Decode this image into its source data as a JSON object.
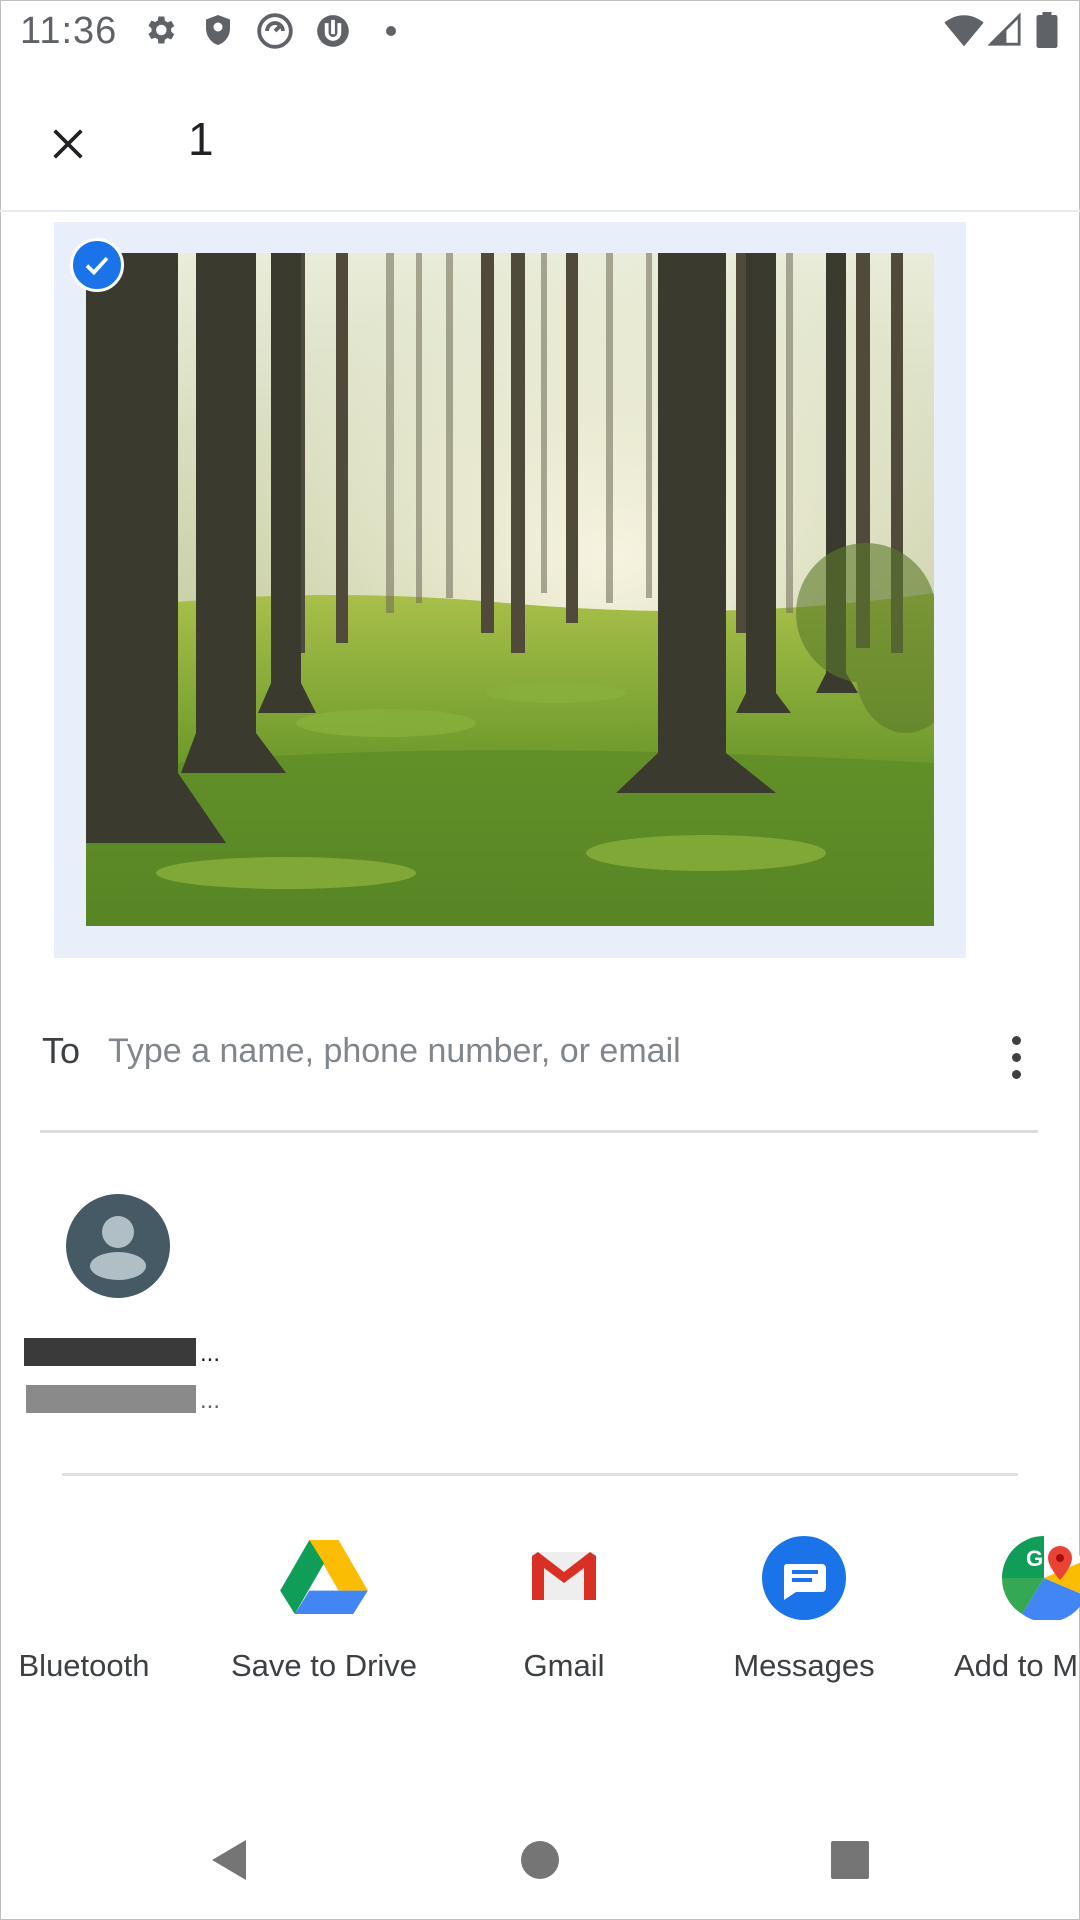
{
  "status_bar": {
    "time": "11:36",
    "left_icons": [
      "settings-icon",
      "shield-icon",
      "speed-icon",
      "torrent-icon",
      "dot-icon"
    ],
    "right_icons": [
      "wifi-icon",
      "signal-icon",
      "battery-icon"
    ]
  },
  "top_bar": {
    "close_icon": "close-icon",
    "selected_count": "1"
  },
  "preview": {
    "selected": true,
    "check_icon": "check-circle-icon"
  },
  "recipient": {
    "label": "To",
    "placeholder": "Type a name, phone number, or email",
    "value": "",
    "more_icon": "more-vert-icon"
  },
  "contact": {
    "avatar_icon": "person-icon",
    "name_ellipsis": "...",
    "detail_ellipsis": "..."
  },
  "share_targets": [
    {
      "label": "Bluetooth",
      "icon": "bluetooth-icon"
    },
    {
      "label": "Save to Drive",
      "icon": "drive-icon"
    },
    {
      "label": "Gmail",
      "icon": "gmail-icon"
    },
    {
      "label": "Messages",
      "icon": "messages-icon"
    },
    {
      "label": "Add to M",
      "icon": "maps-icon"
    }
  ],
  "nav_bar": {
    "back_icon": "back-icon",
    "home_icon": "home-icon",
    "recents_icon": "recents-icon"
  },
  "colors": {
    "accent": "#1a73e8",
    "preview_bg": "#e8effb",
    "text_primary": "#202124",
    "text_secondary": "#5f6368"
  }
}
